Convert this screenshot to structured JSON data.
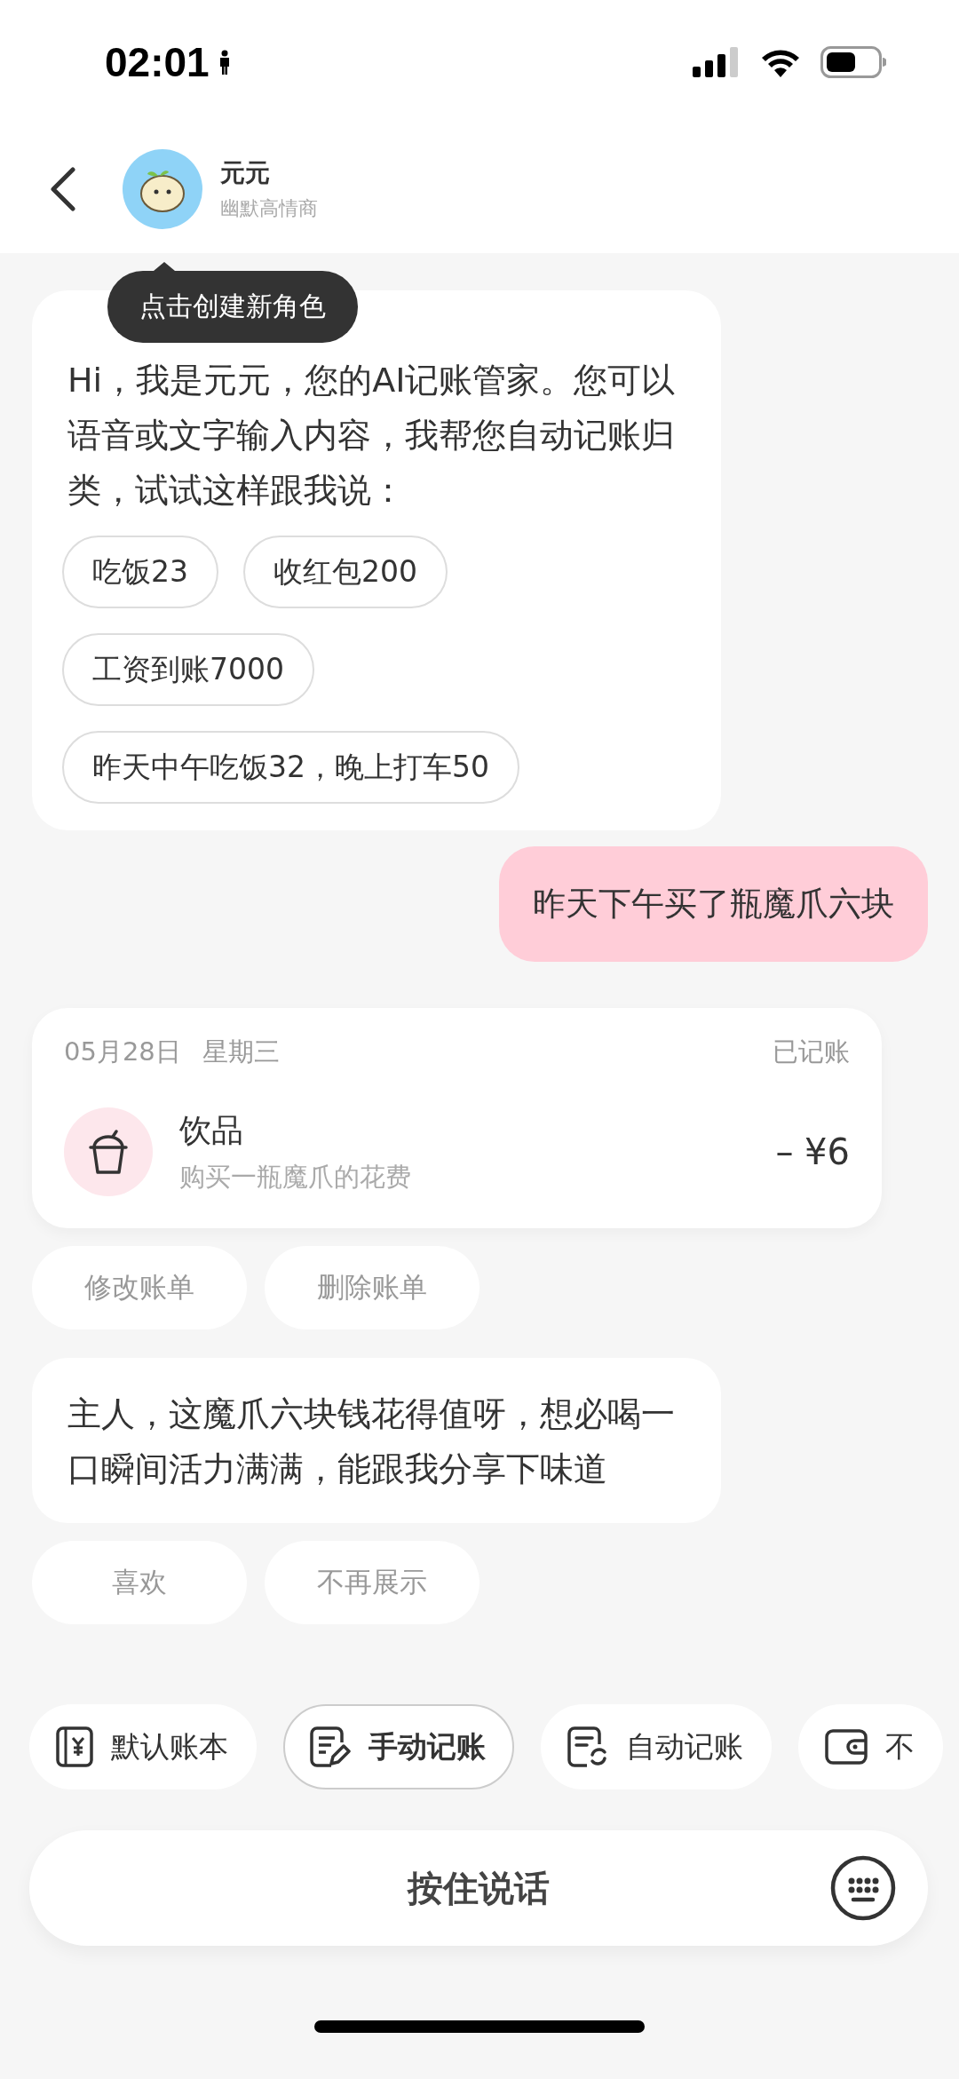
{
  "status_bar": {
    "time": "02:01"
  },
  "header": {
    "name": "元元",
    "subtitle": "幽默高情商",
    "tooltip": "点击创建新角色"
  },
  "messages": [
    {
      "kind": "bot",
      "text": "Hi，我是元元，您的AI记账管家。您可以语音或文字输入内容，我帮您自动记账归类，试试这样跟我说：",
      "suggestions": [
        "吃饭23",
        "收红包200",
        "工资到账7000",
        "昨天中午吃饭32，晚上打车50"
      ]
    },
    {
      "kind": "user",
      "text": "昨天下午买了瓶魔爪六块"
    },
    {
      "kind": "bill",
      "date": "05月28日",
      "weekday": "星期三",
      "status": "已记账",
      "category": "饮品",
      "note": "购买一瓶魔爪的花费",
      "amount": "– ¥6",
      "actions": [
        "修改账单",
        "删除账单"
      ]
    },
    {
      "kind": "bot",
      "text": "主人，这魔爪六块钱花得值呀，想必喝一口瞬间活力满满，能跟我分享下味道",
      "actions": [
        "喜欢",
        "不再展示"
      ]
    }
  ],
  "toolbar": [
    {
      "kind": "book",
      "label": "默认账本",
      "selected": false
    },
    {
      "kind": "manual",
      "label": "手动记账",
      "selected": true
    },
    {
      "kind": "auto",
      "label": "自动记账",
      "selected": false
    },
    {
      "kind": "wallet",
      "label": "不",
      "selected": false
    }
  ],
  "input_bar": {
    "label": "按住说话"
  }
}
